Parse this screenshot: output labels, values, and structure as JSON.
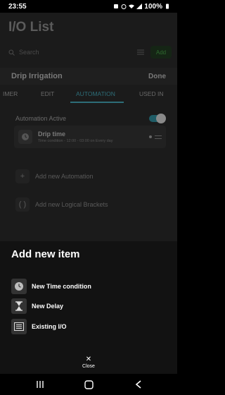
{
  "status_bar": {
    "time": "23:55",
    "battery": "100%"
  },
  "background_screen": {
    "app_title": "I/O List",
    "search": {
      "placeholder": "Search"
    },
    "add_button_label": "Add",
    "sub_header": {
      "title": "Drip Irrigation",
      "done_label": "Done"
    },
    "tabs": [
      {
        "label": "IMER"
      },
      {
        "label": "EDIT"
      },
      {
        "label": "AUTOMATION",
        "active": true
      },
      {
        "label": "USED IN"
      }
    ],
    "automation_active_label": "Automation Active",
    "automation_active_on": true,
    "automation_card": {
      "title": "Drip time",
      "subtitle": "Time condition - 12:00 - 03:00 on Every day"
    },
    "add_automation_label": "Add new Automation",
    "add_brackets_label": "Add new Logical Brackets"
  },
  "bottom_sheet": {
    "title": "Add new item",
    "items": [
      {
        "label": "New Time condition",
        "icon": "clock-icon"
      },
      {
        "label": "New Delay",
        "icon": "hourglass-icon"
      },
      {
        "label": "Existing I/O",
        "icon": "list-icon"
      }
    ],
    "close_label": "Close"
  },
  "colors": {
    "accent": "#2d6d78",
    "sheet_background": "#121212",
    "dimmed_background": "#1b1b1b"
  }
}
